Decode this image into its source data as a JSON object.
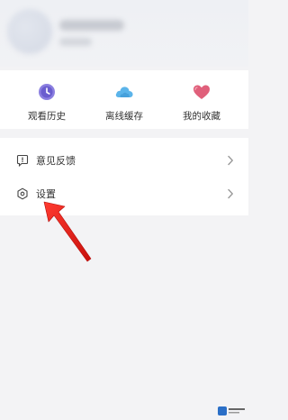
{
  "quick_actions": [
    {
      "label": "观看历史",
      "icon": "clock-icon",
      "color": "#8b7fe0"
    },
    {
      "label": "离线缓存",
      "icon": "cloud-icon",
      "color": "#5bb4ea"
    },
    {
      "label": "我的收藏",
      "icon": "heart-icon",
      "color": "#e0607b"
    }
  ],
  "menu": [
    {
      "label": "意见反馈",
      "icon": "feedback-icon"
    },
    {
      "label": "设置",
      "icon": "settings-gear-icon"
    }
  ],
  "colors": {
    "annotation_arrow": "#e8201c",
    "background": "#f3f3f5",
    "text": "#333333"
  }
}
